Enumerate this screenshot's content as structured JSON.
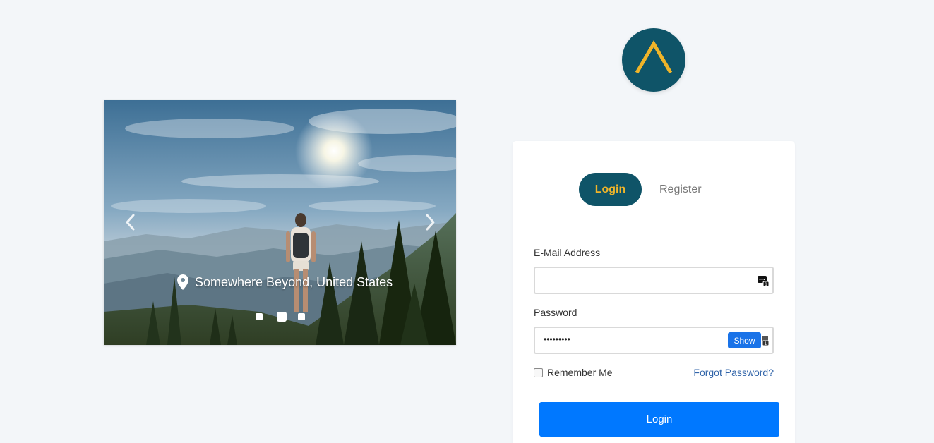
{
  "carousel": {
    "caption": "Somewhere Beyond, United States",
    "prev_icon": "chevron-left-icon",
    "next_icon": "chevron-right-icon",
    "location_icon": "map-pin-icon",
    "slide_count": 3,
    "active_slide": 2
  },
  "logo": {
    "icon": "chevron-up-logo-icon",
    "background_color": "#0f5468",
    "accent_color": "#f0b429"
  },
  "tabs": {
    "login_label": "Login",
    "register_label": "Register",
    "active": "Login"
  },
  "form": {
    "email_label": "E-Mail Address",
    "email_value": "",
    "password_label": "Password",
    "password_masked": "•••••••••",
    "show_label": "Show",
    "remember_label": "Remember Me",
    "remember_checked": false,
    "forgot_label": "Forgot Password?",
    "submit_label": "Login"
  },
  "colors": {
    "primary_button": "#0078ff",
    "tab_active_bg": "#0f5468",
    "tab_active_text": "#f0b429",
    "link": "#3366aa"
  }
}
